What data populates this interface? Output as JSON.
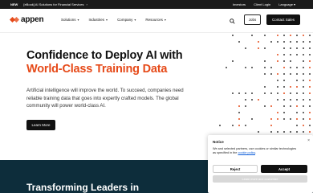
{
  "topbar": {
    "badge": "NEW",
    "message": "[eBook] AI Solutions for Financial Services",
    "arrow_icon": "arrow-right-icon",
    "investors": "Investors",
    "client_login": "Client Login",
    "language": "Language"
  },
  "nav": {
    "logo_text": "appen",
    "menu": [
      {
        "label": "Solutions"
      },
      {
        "label": "Industries"
      },
      {
        "label": "Company"
      },
      {
        "label": "Resources"
      }
    ],
    "jobs_label": "Jobs",
    "contact_label": "Contact Sales"
  },
  "hero": {
    "title_line1": "Confidence to Deploy AI with",
    "title_line2": "World-Class Training Data",
    "body": "Artificial intelligence will improve the world. To succeed, companies need reliable training data that goes into expertly crafted models. The global community will power world-class AI.",
    "cta_label": "Learn More"
  },
  "band": {
    "title": "Transforming Leaders in"
  },
  "cookie": {
    "title": "Notice",
    "text": "We and selected partners, use cookies or similar technologies as specified in the",
    "link": "cookie policy",
    "reject_label": "Reject",
    "accept_label": "Accept",
    "manage_label": "Learn more and customize",
    "close_glyph": "×"
  },
  "colors": {
    "accent": "#e64a19",
    "dark": "#111111",
    "band": "#0d2d3b"
  }
}
